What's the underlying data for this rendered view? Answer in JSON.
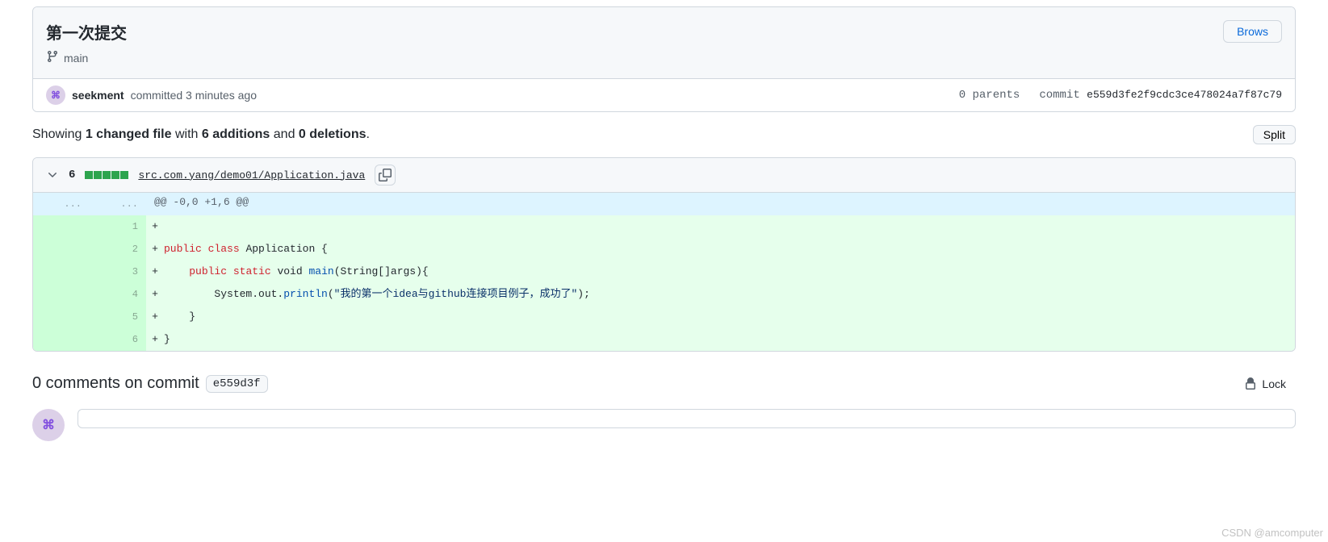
{
  "commit": {
    "title": "第一次提交",
    "branch": "main",
    "browse_label": "Brows",
    "author": "seekment",
    "action_text": "committed 3 minutes ago",
    "parents_text": "0 parents",
    "commit_label": "commit",
    "hash_full": "e559d3fe2f9cdc3ce478024a7f87c79",
    "hash_short": "e559d3f"
  },
  "summary": {
    "prefix": "Showing ",
    "files_bold": "1 changed file",
    "with": " with ",
    "adds_bold": "6 additions",
    "and": " and ",
    "dels_bold": "0 deletions",
    "suffix": ".",
    "split_label": "Split"
  },
  "file": {
    "changes_count": "6",
    "path": "src.com.yang/demo01/Application.java",
    "hunk_header": "@@ -0,0 +1,6 @@",
    "lines": [
      {
        "newnum": "1",
        "marker": "+",
        "segments": []
      },
      {
        "newnum": "2",
        "marker": "+",
        "segments": [
          {
            "t": "public",
            "c": "kw-red"
          },
          {
            "t": " "
          },
          {
            "t": "class",
            "c": "kw-red"
          },
          {
            "t": " Application {"
          }
        ]
      },
      {
        "newnum": "3",
        "marker": "+",
        "segments": [
          {
            "t": "    "
          },
          {
            "t": "public",
            "c": "kw-red"
          },
          {
            "t": " "
          },
          {
            "t": "static",
            "c": "kw-red"
          },
          {
            "t": " void "
          },
          {
            "t": "main",
            "c": "kw-blue"
          },
          {
            "t": "(String[]args){"
          }
        ]
      },
      {
        "newnum": "4",
        "marker": "+",
        "segments": [
          {
            "t": "        System.out."
          },
          {
            "t": "println",
            "c": "kw-blue"
          },
          {
            "t": "("
          },
          {
            "t": "\"我的第一个idea与github连接项目例子，成功了\"",
            "c": "str"
          },
          {
            "t": ");"
          }
        ]
      },
      {
        "newnum": "5",
        "marker": "+",
        "segments": [
          {
            "t": "    }"
          }
        ]
      },
      {
        "newnum": "6",
        "marker": "+",
        "segments": [
          {
            "t": "}"
          }
        ]
      }
    ]
  },
  "comments": {
    "count_prefix": "0 comments on commit ",
    "lock_label": "Lock"
  },
  "watermark": "CSDN @amcomputer"
}
